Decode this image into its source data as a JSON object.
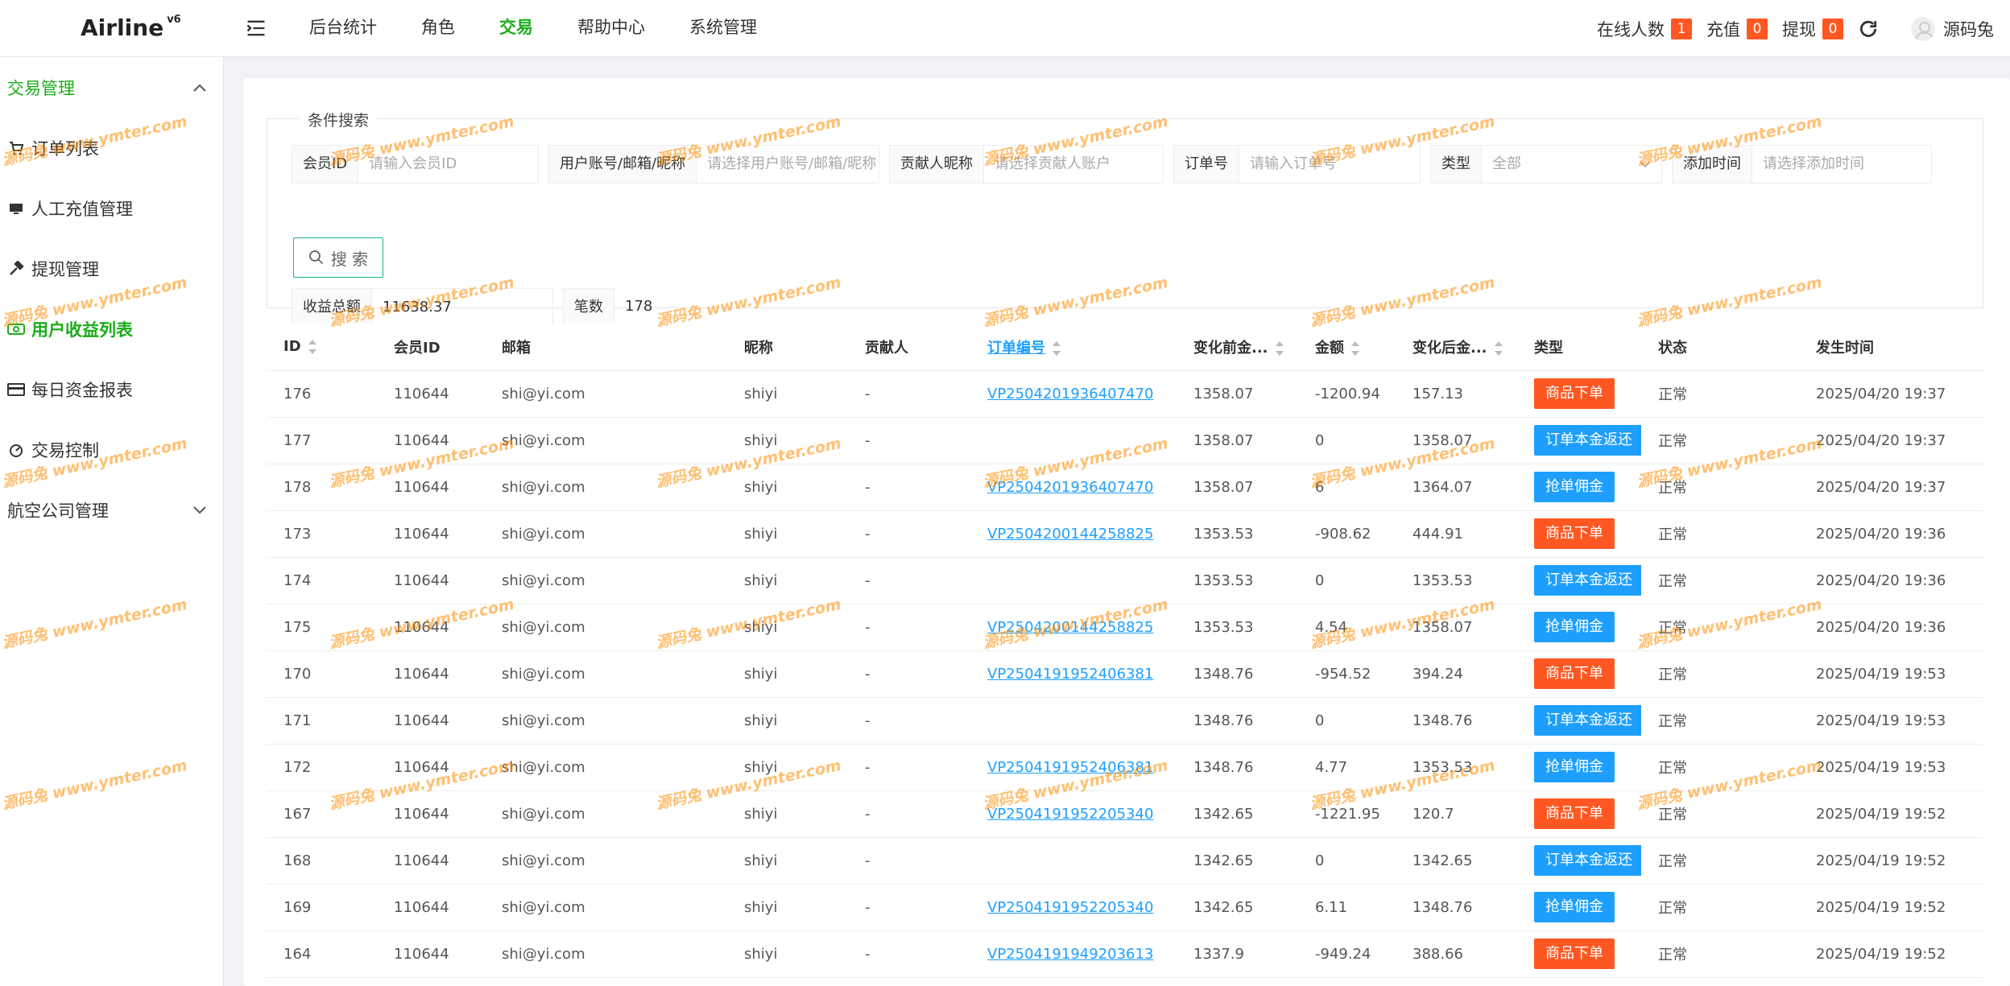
{
  "header": {
    "logo": "Airline",
    "version": "v6",
    "nav": [
      "后台统计",
      "角色",
      "交易",
      "帮助中心",
      "系统管理"
    ],
    "nav_active": "交易",
    "stats": [
      {
        "label": "在线人数",
        "count": "1"
      },
      {
        "label": "充值",
        "count": "0"
      },
      {
        "label": "提现",
        "count": "0"
      }
    ],
    "user": "源码兔"
  },
  "sidebar": {
    "group1": "交易管理",
    "items": [
      "订单列表",
      "人工充值管理",
      "提现管理",
      "用户收益列表",
      "每日资金报表",
      "交易控制"
    ],
    "active": "用户收益列表",
    "group2": "航空公司管理"
  },
  "search": {
    "legend": "条件搜索",
    "fields": [
      {
        "label": "会员ID",
        "placeholder": "请输入会员ID"
      },
      {
        "label": "用户账号/邮箱/昵称",
        "placeholder": "请选择用户账号/邮箱/昵称"
      },
      {
        "label": "贡献人昵称",
        "placeholder": "请选择贡献人账户"
      },
      {
        "label": "订单号",
        "placeholder": "请输入订单号"
      },
      {
        "label": "类型",
        "placeholder": "全部"
      },
      {
        "label": "添加时间",
        "placeholder": "请选择添加时间"
      }
    ],
    "button": "搜 索",
    "total_label": "收益总额",
    "total_value": "11638.37",
    "count_label": "笔数",
    "count_value": "178"
  },
  "table": {
    "columns": [
      "ID",
      "会员ID",
      "邮箱",
      "昵称",
      "贡献人",
      "订单编号",
      "变化前金...",
      "金额",
      "变化后金...",
      "类型",
      "状态",
      "发生时间"
    ],
    "rows": [
      [
        "176",
        "110644",
        "shi@yi.com",
        "shiyi",
        "-",
        "VP2504201936407470",
        "1358.07",
        "-1200.94",
        "157.13",
        "商品下单",
        "正常",
        "2025/04/20 19:37"
      ],
      [
        "177",
        "110644",
        "shi@yi.com",
        "shiyi",
        "-",
        "",
        "1358.07",
        "0",
        "1358.07",
        "订单本金返还",
        "正常",
        "2025/04/20 19:37"
      ],
      [
        "178",
        "110644",
        "shi@yi.com",
        "shiyi",
        "-",
        "VP2504201936407470",
        "1358.07",
        "6",
        "1364.07",
        "抢单佣金",
        "正常",
        "2025/04/20 19:37"
      ],
      [
        "173",
        "110644",
        "shi@yi.com",
        "shiyi",
        "-",
        "VP2504200144258825",
        "1353.53",
        "-908.62",
        "444.91",
        "商品下单",
        "正常",
        "2025/04/20 19:36"
      ],
      [
        "174",
        "110644",
        "shi@yi.com",
        "shiyi",
        "-",
        "",
        "1353.53",
        "0",
        "1353.53",
        "订单本金返还",
        "正常",
        "2025/04/20 19:36"
      ],
      [
        "175",
        "110644",
        "shi@yi.com",
        "shiyi",
        "-",
        "VP2504200144258825",
        "1353.53",
        "4.54",
        "1358.07",
        "抢单佣金",
        "正常",
        "2025/04/20 19:36"
      ],
      [
        "170",
        "110644",
        "shi@yi.com",
        "shiyi",
        "-",
        "VP2504191952406381",
        "1348.76",
        "-954.52",
        "394.24",
        "商品下单",
        "正常",
        "2025/04/19 19:53"
      ],
      [
        "171",
        "110644",
        "shi@yi.com",
        "shiyi",
        "-",
        "",
        "1348.76",
        "0",
        "1348.76",
        "订单本金返还",
        "正常",
        "2025/04/19 19:53"
      ],
      [
        "172",
        "110644",
        "shi@yi.com",
        "shiyi",
        "-",
        "VP2504191952406381",
        "1348.76",
        "4.77",
        "1353.53",
        "抢单佣金",
        "正常",
        "2025/04/19 19:53"
      ],
      [
        "167",
        "110644",
        "shi@yi.com",
        "shiyi",
        "-",
        "VP2504191952205340",
        "1342.65",
        "-1221.95",
        "120.7",
        "商品下单",
        "正常",
        "2025/04/19 19:52"
      ],
      [
        "168",
        "110644",
        "shi@yi.com",
        "shiyi",
        "-",
        "",
        "1342.65",
        "0",
        "1342.65",
        "订单本金返还",
        "正常",
        "2025/04/19 19:52"
      ],
      [
        "169",
        "110644",
        "shi@yi.com",
        "shiyi",
        "-",
        "VP2504191952205340",
        "1342.65",
        "6.11",
        "1348.76",
        "抢单佣金",
        "正常",
        "2025/04/19 19:52"
      ],
      [
        "164",
        "110644",
        "shi@yi.com",
        "shiyi",
        "-",
        "VP2504191949203613",
        "1337.9",
        "-949.24",
        "388.66",
        "商品下单",
        "正常",
        "2025/04/19 19:52"
      ]
    ]
  },
  "watermark": "源码兔 www.ymter.com",
  "colors": {
    "accent": "#1aad19",
    "tag_orange": "#ff5722",
    "tag_blue": "#1e9fff",
    "link": "#1e9fff"
  }
}
